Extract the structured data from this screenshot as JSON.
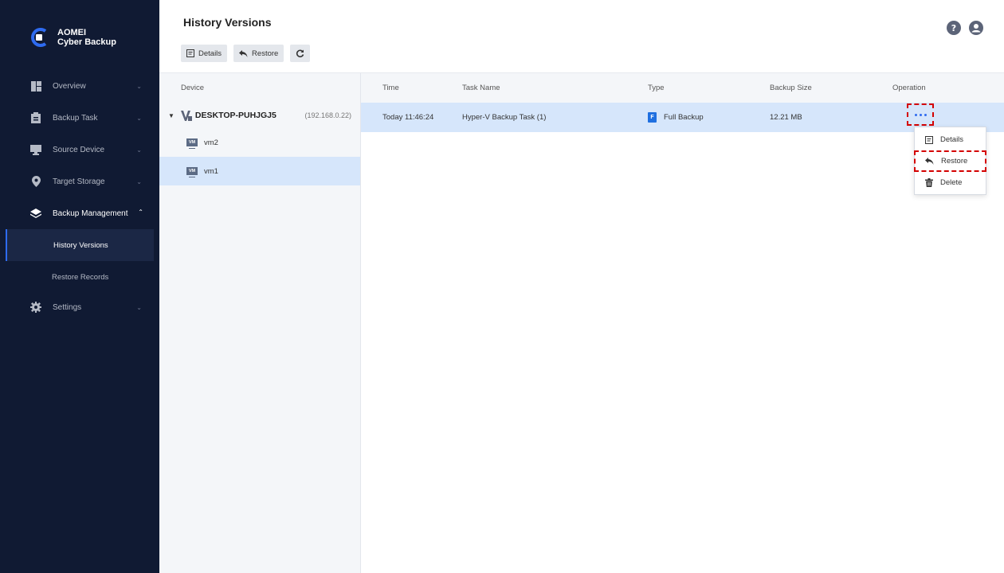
{
  "app": {
    "brand_line1": "AOMEI",
    "brand_line2": "Cyber Backup"
  },
  "sidebar": {
    "items": [
      {
        "label": "Overview",
        "icon": "dashboard-icon"
      },
      {
        "label": "Backup Task",
        "icon": "clipboard-icon"
      },
      {
        "label": "Source Device",
        "icon": "monitor-icon"
      },
      {
        "label": "Target Storage",
        "icon": "location-pin-icon"
      },
      {
        "label": "Backup Management",
        "icon": "layers-icon",
        "expanded": true
      },
      {
        "label": "Settings",
        "icon": "gear-icon"
      }
    ],
    "sub_items": [
      {
        "label": "History Versions",
        "active": true
      },
      {
        "label": "Restore Records"
      }
    ]
  },
  "header": {
    "title": "History Versions",
    "toolbar": {
      "details_label": "Details",
      "restore_label": "Restore"
    }
  },
  "devices": {
    "column_header": "Device",
    "host": {
      "name": "DESKTOP-PUHJGJ5",
      "ip": "(192.168.0.22)"
    },
    "vms": [
      {
        "name": "vm2",
        "badge": "VM"
      },
      {
        "name": "vm1",
        "badge": "VM",
        "selected": true
      }
    ]
  },
  "table": {
    "columns": [
      "Time",
      "Task Name",
      "Type",
      "Backup Size",
      "Operation"
    ],
    "rows": [
      {
        "time": "Today 11:46:24",
        "task": "Hyper-V Backup Task (1)",
        "type_badge": "F",
        "type": "Full Backup",
        "size": "12.21 MB"
      }
    ]
  },
  "dropdown": {
    "items": [
      {
        "label": "Details",
        "icon": "details-icon"
      },
      {
        "label": "Restore",
        "icon": "restore-icon",
        "highlighted": true
      },
      {
        "label": "Delete",
        "icon": "trash-icon"
      }
    ]
  },
  "colors": {
    "sidebar_bg": "#101a33",
    "accent": "#2e6bf0",
    "selected_row": "#d6e6fb",
    "highlight_dash": "#d40000"
  }
}
